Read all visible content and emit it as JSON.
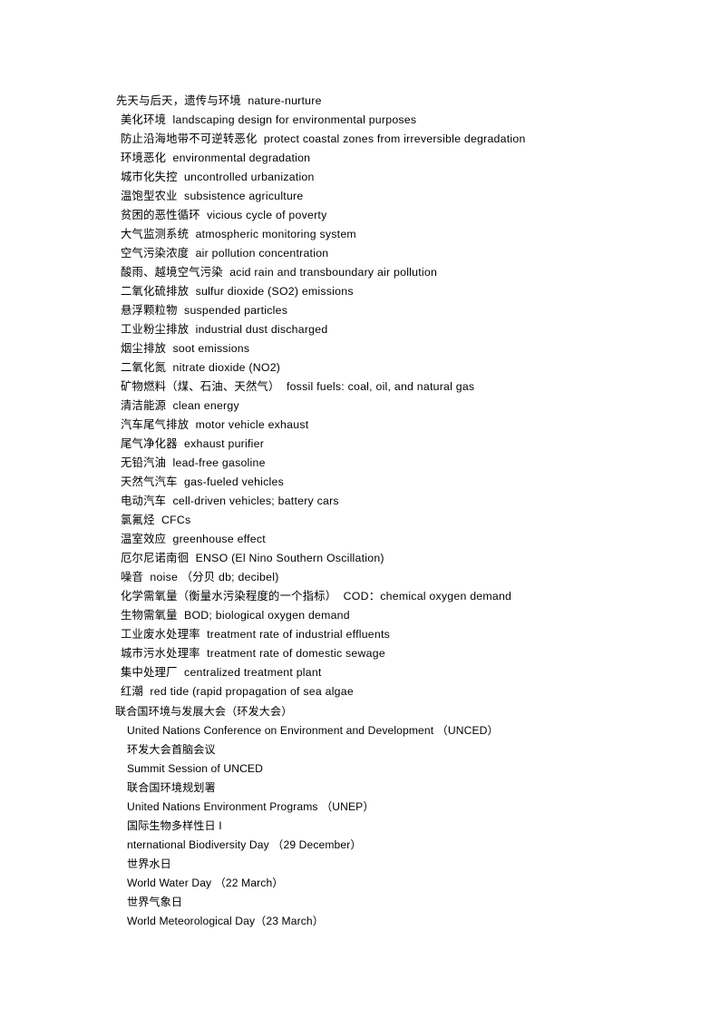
{
  "document": {
    "page_background": "#ffffff",
    "text_color": "#000000",
    "glossary": {
      "lines": [
        {
          "zh": "先天与后天，遗传与环境",
          "en": "nature-nurture",
          "indent": "none"
        },
        {
          "zh": "美化环境",
          "en": "landscaping design for environmental purposes",
          "indent": "small"
        },
        {
          "zh": "防止沿海地带不可逆转恶化",
          "en": "protect coastal zones from irreversible degradation",
          "indent": "small"
        },
        {
          "zh": "环境恶化",
          "en": "environmental degradation",
          "indent": "small"
        },
        {
          "zh": "城市化失控",
          "en": "uncontrolled urbanization",
          "indent": "small"
        },
        {
          "zh": "温饱型农业",
          "en": "subsistence agriculture",
          "indent": "small"
        },
        {
          "zh": "贫困的恶性循环",
          "en": "vicious cycle of poverty",
          "indent": "small"
        },
        {
          "zh": "大气监测系统",
          "en": "atmospheric monitoring system",
          "indent": "small"
        },
        {
          "zh": "空气污染浓度",
          "en": "air pollution concentration",
          "indent": "small"
        },
        {
          "zh": "酸雨、越境空气污染",
          "en": "acid rain and transboundary air pollution",
          "indent": "small"
        },
        {
          "zh": "二氧化硫排放",
          "en": "sulfur dioxide (SO2) emissions",
          "indent": "small"
        },
        {
          "zh": "悬浮颗粒物",
          "en": "suspended particles",
          "indent": "small"
        },
        {
          "zh": "工业粉尘排放",
          "en": "industrial dust discharged",
          "indent": "small"
        },
        {
          "zh": "烟尘排放",
          "en": "soot emissions",
          "indent": "small"
        },
        {
          "zh": "二氧化氮",
          "en": "nitrate dioxide (NO2)",
          "indent": "small"
        },
        {
          "zh": "矿物燃料（煤、石油、天然气）",
          "en": "fossil fuels: coal, oil, and natural gas",
          "indent": "small"
        },
        {
          "zh": "清洁能源",
          "en": "clean energy",
          "indent": "small"
        },
        {
          "zh": "汽车尾气排放",
          "en": "motor vehicle exhaust",
          "indent": "small"
        },
        {
          "zh": "尾气净化器",
          "en": "exhaust purifier",
          "indent": "small"
        },
        {
          "zh": "无铅汽油",
          "en": "lead-free gasoline",
          "indent": "small"
        },
        {
          "zh": "天然气汽车",
          "en": "gas-fueled vehicles",
          "indent": "small"
        },
        {
          "zh": "电动汽车",
          "en": "cell-driven vehicles; battery cars",
          "indent": "small"
        },
        {
          "zh": "氯氟烃",
          "en": "CFCs",
          "indent": "small"
        },
        {
          "zh": "温室效应",
          "en": "greenhouse effect",
          "indent": "small"
        },
        {
          "zh": "厄尔尼诺南徊",
          "en": "ENSO (El Nino Southern Oscillation)",
          "indent": "small"
        },
        {
          "zh": "噪音",
          "en": "noise （分贝 db; decibel)",
          "indent": "small"
        },
        {
          "zh": "化学需氧量（衡量水污染程度的一个指标）",
          "en": "COD：chemical oxygen demand",
          "indent": "small"
        },
        {
          "zh": "生物需氧量",
          "en": "BOD; biological oxygen demand",
          "indent": "small"
        },
        {
          "zh": "工业废水处理率",
          "en": "treatment rate of industrial effluents",
          "indent": "small"
        },
        {
          "zh": "城市污水处理率",
          "en": "treatment rate of domestic sewage",
          "indent": "small"
        },
        {
          "zh": "集中处理厂",
          "en": "centralized treatment plant",
          "indent": "small"
        },
        {
          "zh": "红潮",
          "en": "red tide (rapid propagation of sea algae",
          "indent": "small"
        }
      ]
    },
    "events": {
      "lines": [
        {
          "text": "联合国环境与发展大会（环发大会）",
          "indent": "lead",
          "script": "zh"
        },
        {
          "text": "United Nations Conference on Environment and Development （UNCED）",
          "indent": "sub",
          "script": "en"
        },
        {
          "text": "环发大会首脑会议",
          "indent": "sub",
          "script": "zh"
        },
        {
          "text": "Summit Session of UNCED",
          "indent": "sub",
          "script": "en"
        },
        {
          "text": "联合国环境规划署",
          "indent": "sub",
          "script": "zh"
        },
        {
          "text": "United Nations Environment Programs （UNEP）",
          "indent": "sub",
          "script": "en"
        },
        {
          "text": "国际生物多样性日 I",
          "indent": "sub",
          "script": "zh"
        },
        {
          "text": "nternational Biodiversity Day （29 December）",
          "indent": "sub",
          "script": "en"
        },
        {
          "text": "世界水日",
          "indent": "sub",
          "script": "zh"
        },
        {
          "text": "World Water Day （22 March）",
          "indent": "sub",
          "script": "en"
        },
        {
          "text": "世界气象日",
          "indent": "sub",
          "script": "zh"
        },
        {
          "text": "World Meteorological Day（23 March）",
          "indent": "sub",
          "script": "en"
        }
      ]
    }
  }
}
